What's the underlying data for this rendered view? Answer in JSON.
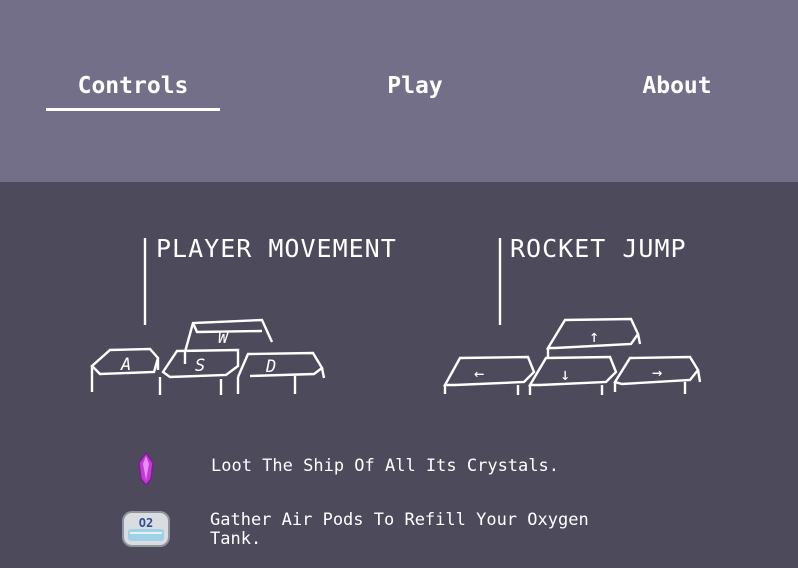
{
  "nav": {
    "tabs": [
      {
        "label": "Controls",
        "active": true
      },
      {
        "label": "Play",
        "active": false
      },
      {
        "label": "About",
        "active": false
      }
    ]
  },
  "controls": {
    "movement": {
      "title": "PLAYER MOVEMENT",
      "keys": [
        "W",
        "A",
        "S",
        "D"
      ]
    },
    "rocket": {
      "title": "ROCKET JUMP",
      "keys": [
        "↑",
        "←",
        "↓",
        "→"
      ]
    }
  },
  "tips": [
    {
      "icon": "crystal-icon",
      "text": "Loot The Ship Of All Its Crystals."
    },
    {
      "icon": "oxygen-pod-icon",
      "icon_label": "O2",
      "text": "Gather Air Pods To Refill Your Oxygen Tank."
    }
  ],
  "colors": {
    "header_bg": "#736f88",
    "body_bg": "#4d4a5c",
    "text": "#ffffff",
    "crystal": "#c23ad6"
  }
}
